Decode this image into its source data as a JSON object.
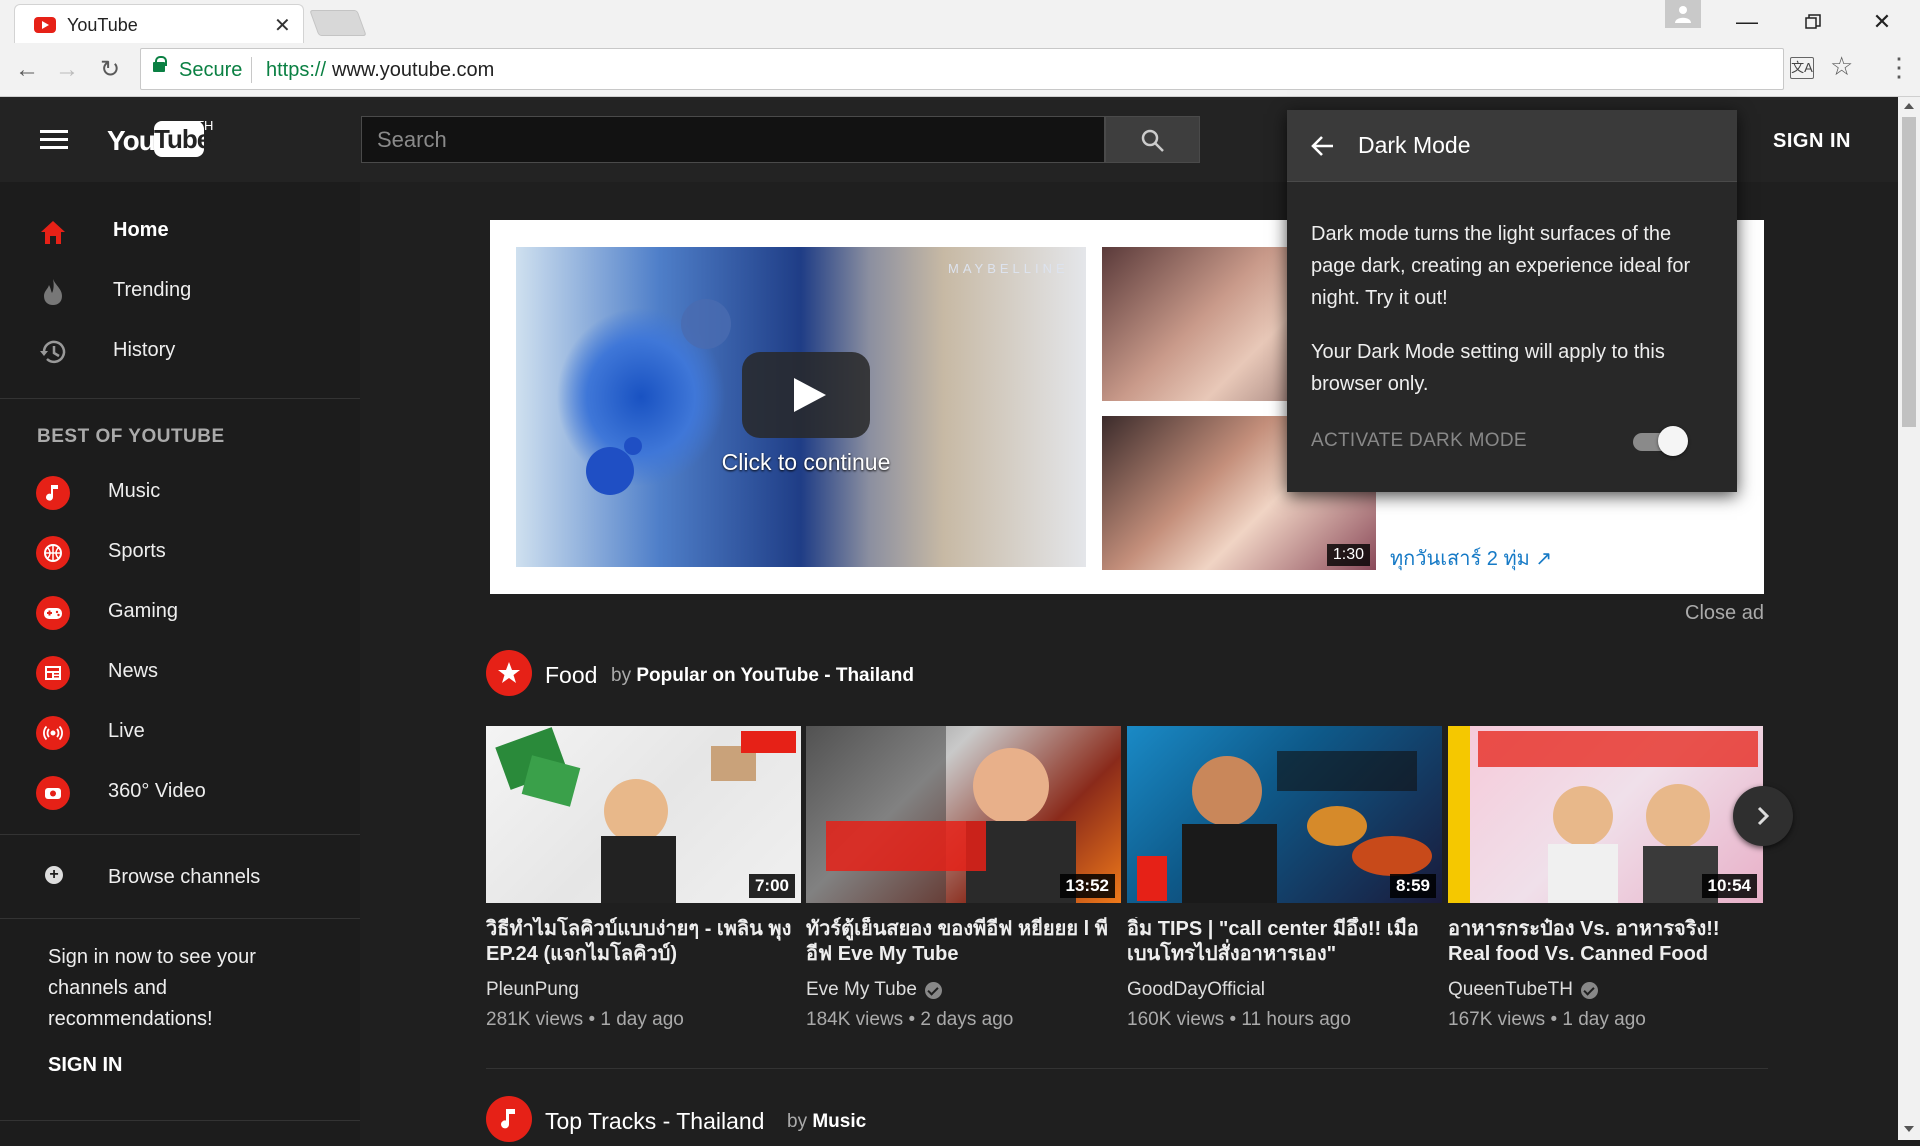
{
  "browser": {
    "tab_title": "YouTube",
    "secure_label": "Secure",
    "url_scheme": "https://",
    "url_host": "www.youtube.com"
  },
  "masthead": {
    "logo_you": "You",
    "logo_tube": "Tube",
    "country_code": "TH",
    "search_placeholder": "Search",
    "sign_in": "SIGN IN"
  },
  "sidebar": {
    "nav": [
      {
        "label": "Home",
        "icon": "home-icon",
        "active": true
      },
      {
        "label": "Trending",
        "icon": "trending-icon"
      },
      {
        "label": "History",
        "icon": "history-icon"
      }
    ],
    "best_heading": "BEST OF YOUTUBE",
    "best": [
      {
        "label": "Music",
        "icon": "music-icon"
      },
      {
        "label": "Sports",
        "icon": "sports-icon"
      },
      {
        "label": "Gaming",
        "icon": "gaming-icon"
      },
      {
        "label": "News",
        "icon": "news-icon"
      },
      {
        "label": "Live",
        "icon": "live-icon"
      },
      {
        "label": "360° Video",
        "icon": "360-video-icon"
      }
    ],
    "browse_channels": "Browse channels",
    "signin_message": "Sign in now to see your channels and recommendations!",
    "sign_in": "SIGN IN"
  },
  "ad": {
    "brand": "MAYBELLINE",
    "click_to_continue": "Click to continue",
    "thumb2_duration": "1:30",
    "link_text": "ทุกวันเสาร์ 2 ทุ่ม",
    "close_ad": "Close ad"
  },
  "shelves": [
    {
      "title": "Food",
      "by": "by",
      "owner": "Popular on YouTube - Thailand",
      "icon": "star-icon",
      "videos": [
        {
          "title": "วิธีทำไมโลคิวบ์แบบง่ายๆ - เพลิน พุง EP.24 (แจกไมโลคิวบ์)",
          "channel": "PleunPung",
          "verified": false,
          "views": "281K views",
          "age": "1 day ago",
          "duration": "7:00"
        },
        {
          "title": "ทัวร์ตู้เย็นสยอง ของพี่อีฟ หยี๋ยยย l พี่อีฟ Eve My Tube",
          "channel": "Eve My Tube",
          "verified": true,
          "views": "184K views",
          "age": "2 days ago",
          "duration": "13:52"
        },
        {
          "title": "อิ่ม TIPS | \"call center มีอึ้ง!! เมื่อเบนโทรไปสั่งอาหารเอง\"",
          "channel": "GoodDayOfficial",
          "verified": false,
          "views": "160K views",
          "age": "11 hours ago",
          "duration": "8:59"
        },
        {
          "title": "อาหารกระป๋อง Vs. อาหารจริง!! Real food Vs. Canned Food",
          "channel": "QueenTubeTH",
          "verified": true,
          "views": "167K views",
          "age": "1 day ago",
          "duration": "10:54"
        }
      ]
    },
    {
      "title": "Top Tracks - Thailand",
      "by": "by",
      "owner": "Music",
      "icon": "music-icon"
    }
  ],
  "dark_mode_popup": {
    "title": "Dark Mode",
    "description": "Dark mode turns the light surfaces of the page dark, creating an experience ideal for night. Try it out!",
    "note": "Your Dark Mode setting will apply to this browser only.",
    "toggle_label": "ACTIVATE DARK MODE",
    "toggle_on": true
  },
  "colors": {
    "accent_red": "#e62117",
    "link_blue": "#167ac6",
    "secure_green": "#0b8043",
    "background": "#1f1f1f"
  }
}
